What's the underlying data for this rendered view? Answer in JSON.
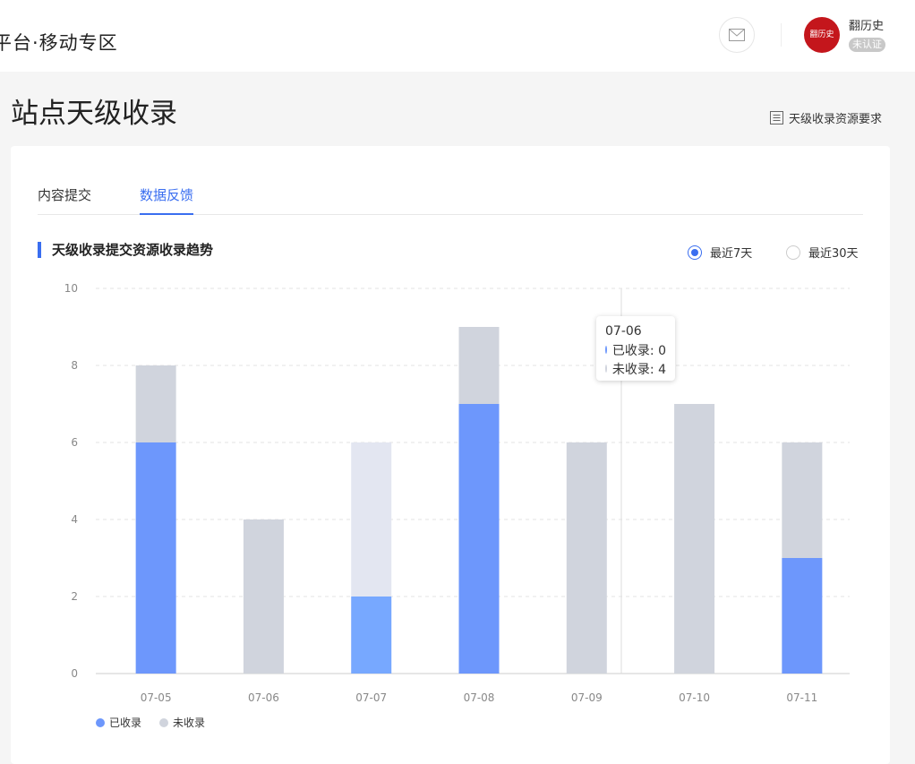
{
  "header": {
    "platform_title": "平台·移动专区",
    "username": "翻历史",
    "avatar_text": "翻历史",
    "cert_status": "未认证"
  },
  "page": {
    "title": "站点天级收录",
    "requirement_link": "天级收录资源要求"
  },
  "tabs": [
    {
      "label": "内容提交",
      "active": false
    },
    {
      "label": "数据反馈",
      "active": true
    }
  ],
  "section": {
    "title": "天级收录提交资源收录趋势",
    "range_options": [
      {
        "label": "最近7天",
        "checked": true
      },
      {
        "label": "最近30天",
        "checked": false
      }
    ]
  },
  "tooltip": {
    "date": "07-06",
    "indexed_label": "已收录: 0",
    "not_indexed_label": "未收录: 4"
  },
  "colors": {
    "accent": "#3a6ef0",
    "indexed": "#6d97fc",
    "not_indexed": "#d0d4dd",
    "highlight_indexed": "#77a8ff",
    "highlight_not_indexed": "#e3e6f1"
  },
  "chart_data": {
    "type": "bar",
    "stacked": true,
    "categories": [
      "07-05",
      "07-06",
      "07-07",
      "07-08",
      "07-09",
      "07-10",
      "07-11"
    ],
    "series": [
      {
        "name": "已收录",
        "values": [
          6,
          0,
          2,
          7,
          0,
          0,
          3
        ]
      },
      {
        "name": "未收录",
        "values": [
          2,
          4,
          4,
          2,
          6,
          7,
          3
        ]
      }
    ],
    "ylim": [
      0,
      10
    ],
    "yticks": [
      0,
      2,
      4,
      6,
      8,
      10
    ],
    "grid": true,
    "legend_position": "bottom-left",
    "highlighted_category": "07-07"
  }
}
